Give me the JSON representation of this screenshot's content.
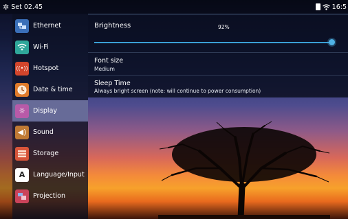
{
  "status_bar": {
    "title": "Set 02.45",
    "time": "16:5"
  },
  "sidebar": {
    "items": [
      {
        "label": "Ethernet",
        "icon": "ethernet-icon",
        "color": "#3a6fb8"
      },
      {
        "label": "Wi-Fi",
        "icon": "wifi-icon",
        "color": "#2fa79a"
      },
      {
        "label": "Hotspot",
        "icon": "hotspot-icon",
        "color": "#d2452c"
      },
      {
        "label": "Date & time",
        "icon": "clock-icon",
        "color": "#e07b2a"
      },
      {
        "label": "Display",
        "icon": "display-icon",
        "color": "#b85aa8",
        "active": true
      },
      {
        "label": "Sound",
        "icon": "speaker-icon",
        "color": "#c07a35"
      },
      {
        "label": "Storage",
        "icon": "storage-icon",
        "color": "#d8553a"
      },
      {
        "label": "Language/Input",
        "icon": "language-icon",
        "color": "#ffffff"
      },
      {
        "label": "Projection",
        "icon": "projection-icon",
        "color": "#c9435a"
      }
    ]
  },
  "display": {
    "brightness_label": "Brightness",
    "brightness_value": "92%",
    "brightness_level": 0.99,
    "font_size_label": "Font size",
    "font_size_value": "Medium",
    "sleep_label": "Sleep Time",
    "sleep_value": "Always bright screen (note: will continue to power consumption)"
  },
  "colors": {
    "accent": "#4fb2e6",
    "active_item": "#676b98"
  }
}
